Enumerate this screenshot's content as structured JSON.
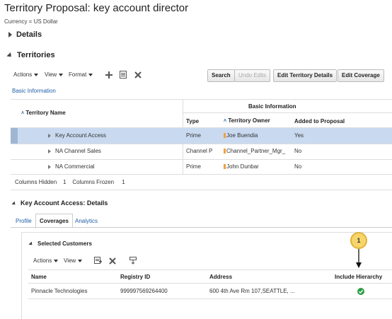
{
  "title": "Territory Proposal: key account director",
  "currency": "Currency = US Dollar",
  "sections": {
    "details": "Details",
    "territories": "Territories",
    "detail_panel": "Key Account Access: Details"
  },
  "toolbar": {
    "actions": "Actions",
    "view": "View",
    "format": "Format",
    "buttons": [
      "Search",
      "Undo Edits",
      "Edit Territory Details",
      "Edit Coverage"
    ]
  },
  "basic_information_link": "Basic Information",
  "grid": {
    "group_header": "Basic Information",
    "columns": [
      "Territory Name",
      "Type",
      "Territory Owner",
      "Added to Proposal"
    ],
    "rows": [
      {
        "name": "Key Account Access",
        "type": "Prime",
        "owner": "Joe Buendia",
        "added": "Yes",
        "selected": true
      },
      {
        "name": "NA Channel Sales",
        "type": "Channel P",
        "owner": "Channel_Partner_Mgr_",
        "added": "No",
        "selected": false
      },
      {
        "name": "NA Commercial",
        "type": "Prime",
        "owner": "John Dunbar",
        "added": "No",
        "selected": false
      }
    ]
  },
  "columns_status": {
    "hidden_label": "Columns Hidden",
    "hidden_value": "1",
    "frozen_label": "Columns Frozen",
    "frozen_value": "1"
  },
  "tabs": [
    "Profile",
    "Coverages",
    "Analytics"
  ],
  "selected_customers": {
    "title": "Selected Customers",
    "actions": "Actions",
    "view": "View",
    "columns": [
      "Name",
      "Registry ID",
      "Address",
      "Include Hierarchy"
    ],
    "rows": [
      {
        "name": "Pinnacle Technologies",
        "registry_id": "999997569264400",
        "address": "600 4th Ave Rm 107,SEATTLE, ...",
        "include_hierarchy": true
      }
    ]
  },
  "callout_number": "1",
  "colors": {
    "selected_row": "#c9daf0",
    "link": "#1f5fa8",
    "check": "#2e9e46",
    "callout": "#f7d56b"
  }
}
